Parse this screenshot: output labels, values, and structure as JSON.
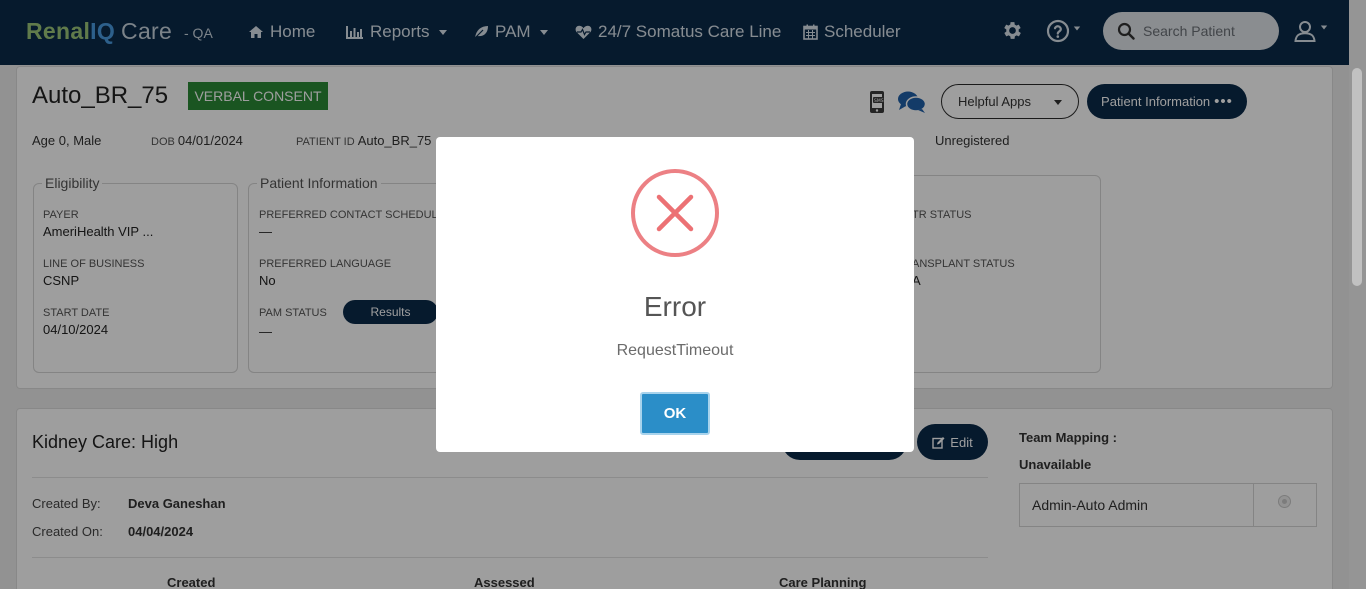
{
  "navbar": {
    "brand_part1": "Renal",
    "brand_part2": "IQ",
    "brand_part3": "Care",
    "env": "- QA",
    "items": [
      {
        "label": "Home",
        "icon": "home-icon"
      },
      {
        "label": "Reports",
        "icon": "bar-chart-icon"
      },
      {
        "label": "PAM",
        "icon": "leaf-icon"
      },
      {
        "label": "24/7 Somatus Care Line",
        "icon": "heartbeat-icon"
      },
      {
        "label": "Scheduler",
        "icon": "calendar-icon"
      }
    ],
    "search_placeholder": "Search Patient"
  },
  "patient": {
    "name": "Auto_BR_75",
    "consent": "VERBAL CONSENT",
    "age_sex": "Age 0, Male",
    "dob_label": "DOB",
    "dob": "04/01/2024",
    "id_label": "PATIENT ID",
    "id": "Auto_BR_75",
    "status_value": "Unregistered",
    "helpful_apps": "Helpful Apps",
    "patient_info_btn": "Patient Information",
    "patient_info_dots": "•••"
  },
  "eligibility": {
    "title": "Eligibility",
    "payer_label": "PAYER",
    "payer": "AmeriHealth VIP ...",
    "lob_label": "LINE OF BUSINESS",
    "lob": "CSNP",
    "start_label": "START DATE",
    "start": "04/10/2024"
  },
  "patient_information": {
    "title": "Patient Information",
    "contact_label": "PREFERRED CONTACT SCHEDULE",
    "contact": "—",
    "lang_label": "PREFERRED LANGUAGE",
    "lang": "No",
    "pam_label": "PAM STATUS",
    "pam": "—",
    "results_btn": "Results"
  },
  "right_panel": {
    "status1_label": "TR STATUS",
    "status2_label": "ANSPLANT STATUS",
    "status2_value": "A"
  },
  "kidney_care": {
    "title": "Kidney Care: High",
    "edit_label": "Edit",
    "created_by_label": "Created By:",
    "created_by": "Deva Ganeshan",
    "created_on_label": "Created On:",
    "created_on": "04/04/2024",
    "columns": [
      "Created",
      "Assessed",
      "Care Planning"
    ]
  },
  "team_mapping": {
    "title": "Team Mapping :",
    "status": "Unavailable",
    "member": "Admin-Auto Admin"
  },
  "modal": {
    "title": "Error",
    "message": "RequestTimeout",
    "ok_label": "OK"
  },
  "colors": {
    "navbar": "#0a2a4a",
    "consent_green": "#2a8a36",
    "error_red": "#e8777a",
    "ok_blue": "#2b8ec8"
  }
}
